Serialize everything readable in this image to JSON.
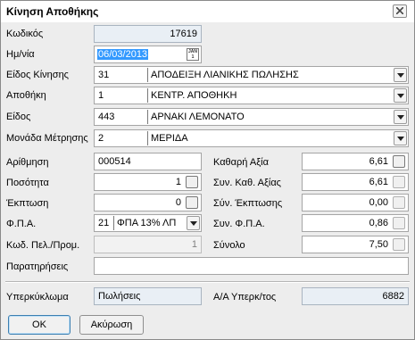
{
  "window": {
    "title": "Κίνηση Αποθήκης"
  },
  "fields": {
    "code": {
      "label": "Κωδικός",
      "value": "17619"
    },
    "date": {
      "label": "Ημ/νία",
      "value": "06/03/2013",
      "cal_top": "JAN",
      "cal_bottom": "1"
    },
    "movement_type": {
      "label": "Είδος Κίνησης",
      "code": "31",
      "name": "ΑΠΟΔΕΙΞΗ ΛΙΑΝΙΚΗΣ ΠΩΛΗΣΗΣ"
    },
    "warehouse": {
      "label": "Αποθήκη",
      "code": "1",
      "name": "ΚΕΝΤΡ. ΑΠΟΘΗΚΗ"
    },
    "item": {
      "label": "Είδος",
      "code": "443",
      "name": "ΑΡΝΑΚΙ ΛΕΜΟΝΑΤΟ"
    },
    "unit": {
      "label": "Μονάδα Μέτρησης",
      "code": "2",
      "name": "ΜΕΡΙΔΑ"
    },
    "number": {
      "label": "Αρίθμηση",
      "value": "000514"
    },
    "quantity": {
      "label": "Ποσότητα",
      "value": "1"
    },
    "discount": {
      "label": "Έκπτωση",
      "value": "0"
    },
    "vat": {
      "label": "Φ.Π.Α.",
      "code": "21",
      "name": "ΦΠΑ 13% ΛΠ"
    },
    "price_list": {
      "label": "Κωδ. Πελ./Προμ.",
      "value": "1"
    },
    "net_value": {
      "label": "Καθαρή Αξία",
      "value": "6,61"
    },
    "total_net_value": {
      "label": "Συν. Καθ. Αξίας",
      "value": "6,61"
    },
    "total_discount": {
      "label": "Σύν. Έκπτωσης",
      "value": "0,00"
    },
    "total_vat": {
      "label": "Συν. Φ.Π.Α.",
      "value": "0,86"
    },
    "total": {
      "label": "Σύνολο",
      "value": "7,50"
    },
    "notes": {
      "label": "Παρατηρήσεις",
      "value": ""
    },
    "parent_circle": {
      "label": "Υπερκύκλωμα",
      "value": "Πωλήσεις"
    },
    "parent_seq": {
      "label": "Α/Α Υπερκ/τος",
      "value": "6882"
    }
  },
  "buttons": {
    "ok": "OK",
    "cancel": "Ακύρωση"
  }
}
